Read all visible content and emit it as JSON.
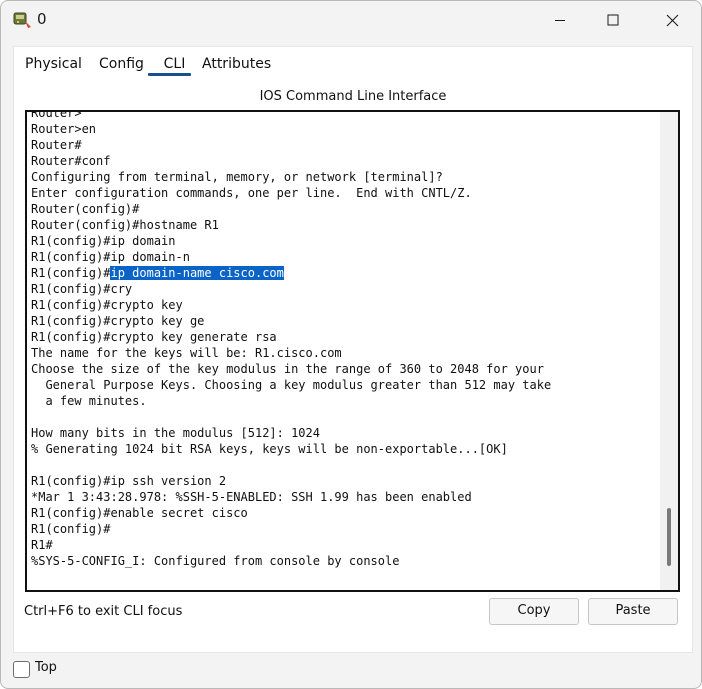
{
  "window": {
    "title": "0"
  },
  "tabs": [
    {
      "label": "Physical"
    },
    {
      "label": "Config"
    },
    {
      "label": "CLI"
    },
    {
      "label": "Attributes"
    }
  ],
  "active_tab": "CLI",
  "panel_title": "IOS Command Line Interface",
  "terminal": {
    "lines": [
      "Router>",
      "Router>en",
      "Router#",
      "Router#conf",
      "Configuring from terminal, memory, or network [terminal]?",
      "Enter configuration commands, one per line.  End with CNTL/Z.",
      "Router(config)#",
      "Router(config)#hostname R1",
      "R1(config)#ip domain",
      "R1(config)#ip domain-n",
      "R1(config)#ip domain-name cisco.com",
      "R1(config)#cry",
      "R1(config)#crypto key",
      "R1(config)#crypto key ge",
      "R1(config)#crypto key generate rsa",
      "The name for the keys will be: R1.cisco.com",
      "Choose the size of the key modulus in the range of 360 to 2048 for your",
      "  General Purpose Keys. Choosing a key modulus greater than 512 may take",
      "  a few minutes.",
      "",
      "How many bits in the modulus [512]: 1024",
      "% Generating 1024 bit RSA keys, keys will be non-exportable...[OK]",
      "",
      "R1(config)#ip ssh version 2",
      "*Mar 1 3:43:28.978: %SSH-5-ENABLED: SSH 1.99 has been enabled",
      "R1(config)#enable secret cisco",
      "R1(config)#",
      "R1#",
      "%SYS-5-CONFIG_I: Configured from console by console"
    ],
    "selection": {
      "prompt": "R1(config)#",
      "text": "ip domain-name cisco.com"
    }
  },
  "footer": {
    "hint": "Ctrl+F6 to exit CLI focus",
    "copy_label": "Copy",
    "paste_label": "Paste"
  },
  "top_checkbox": {
    "label": "Top",
    "checked": false
  }
}
